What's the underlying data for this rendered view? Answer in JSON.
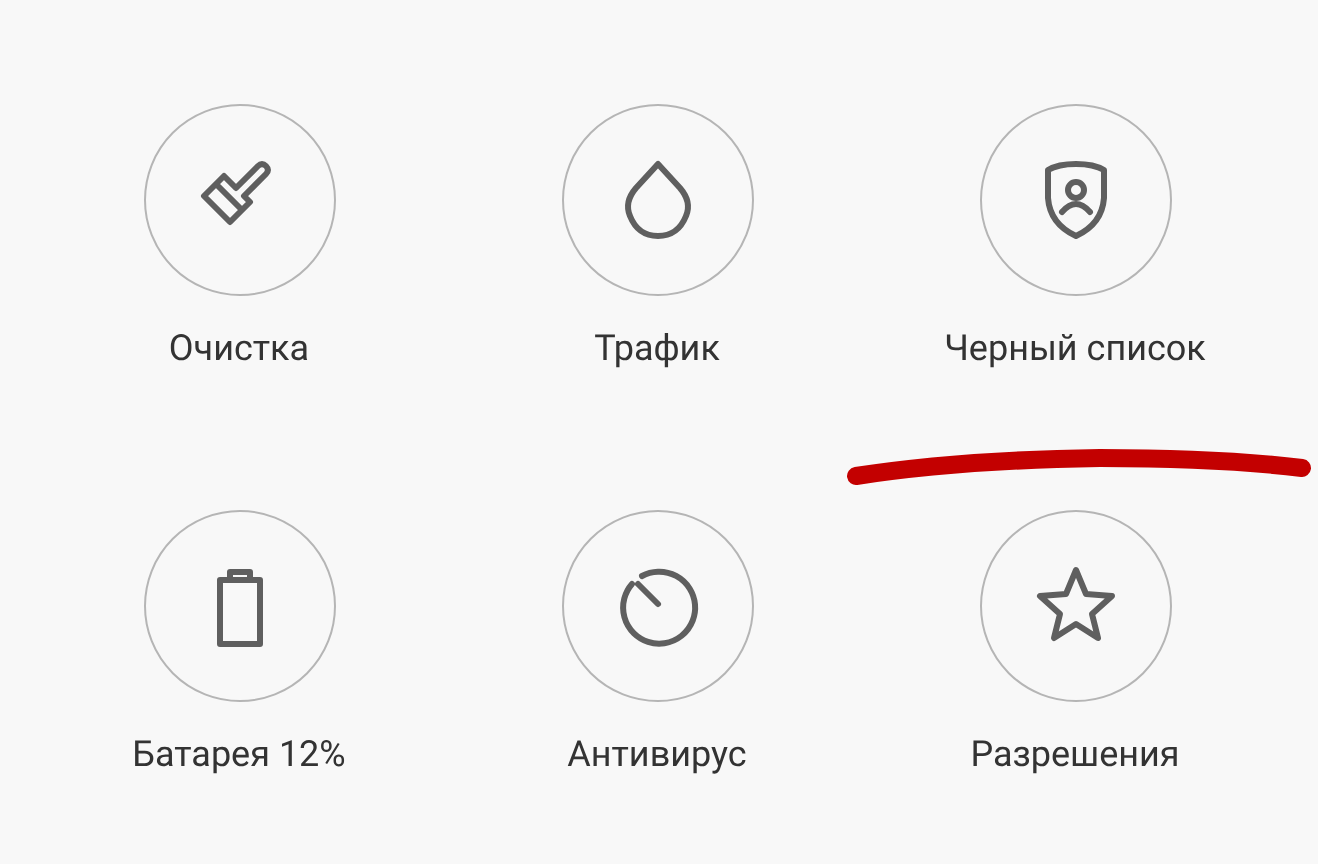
{
  "tiles": [
    {
      "label": "Очистка"
    },
    {
      "label": "Трафик"
    },
    {
      "label": "Черный список"
    },
    {
      "label": "Батарея 12%"
    },
    {
      "label": "Антивирус"
    },
    {
      "label": "Разрешения"
    }
  ],
  "annotation": {
    "kind": "underline"
  }
}
